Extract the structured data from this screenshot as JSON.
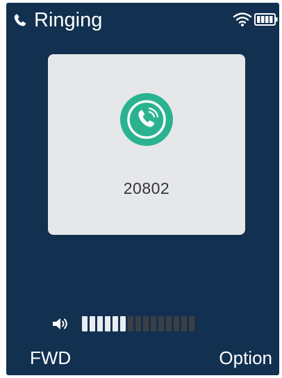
{
  "status": {
    "text": "Ringing",
    "phone_icon": "phone-handset-icon",
    "wifi_icon": "wifi-icon",
    "battery_icon": "battery-icon"
  },
  "call": {
    "number": "20802",
    "avatar_icon": "incoming-call-icon",
    "accent_color": "#2bb391"
  },
  "volume": {
    "icon": "speaker-icon",
    "level": 6,
    "max": 15
  },
  "softkeys": {
    "left": "FWD",
    "right": "Option"
  },
  "colors": {
    "background": "#12304f",
    "card": "#e6e7e9"
  }
}
